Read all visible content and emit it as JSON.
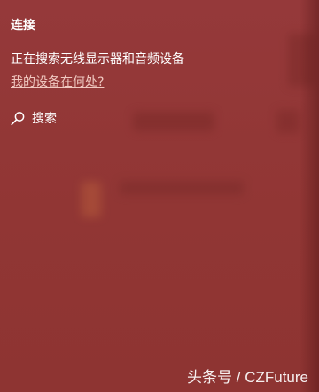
{
  "panel": {
    "title": "连接",
    "status_text": "正在搜索无线显示器和音频设备",
    "help_link": "我的设备在何处?",
    "search": {
      "label": "搜索",
      "icon": "search-icon"
    }
  },
  "colors": {
    "background": "#923733",
    "text": "#ffffff",
    "link": "#f0c8c0"
  },
  "watermark": "头条号 / CZFuture"
}
